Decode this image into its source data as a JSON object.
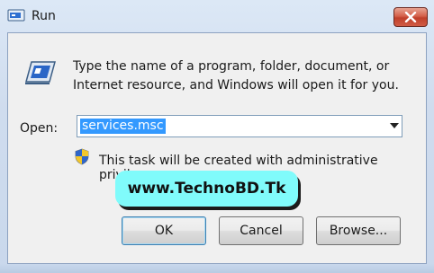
{
  "window": {
    "title": "Run",
    "close_icon": "close-icon",
    "app_icon": "run-icon"
  },
  "dialog": {
    "description": "Type the name of a program, folder, document, or Internet resource, and Windows will open it for you.",
    "big_icon": "run-program-icon",
    "open_label": "Open:",
    "open_value": "services.msc",
    "admin_note": "This task will be created with administrative privileges.",
    "shield_icon": "uac-shield-icon"
  },
  "watermark": {
    "text": "www.TechnoBD.Tk",
    "color": "#80fbfb"
  },
  "buttons": {
    "ok": "OK",
    "cancel": "Cancel",
    "browse": "Browse..."
  },
  "colors": {
    "close_button": "#c0402b",
    "selection": "#3399ff",
    "frame": "#d8e4f2"
  }
}
